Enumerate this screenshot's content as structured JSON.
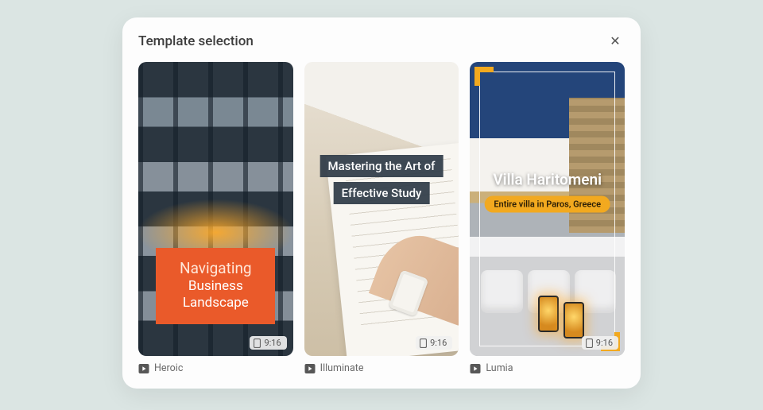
{
  "modal": {
    "title": "Template selection",
    "close_symbol": "✕"
  },
  "templates": [
    {
      "name": "Heroic",
      "duration": "9:16",
      "title_line1": "Navigating",
      "title_line2": "Business",
      "title_line3": "Landscape"
    },
    {
      "name": "Illuminate",
      "duration": "9:16",
      "overlay_line1": "Mastering the Art of",
      "overlay_line2": "Effective Study"
    },
    {
      "name": "Lumia",
      "duration": "9:16",
      "overlay_title": "Villa Haritomeni",
      "overlay_subtitle": "Entire villa in Paros, Greece"
    }
  ]
}
